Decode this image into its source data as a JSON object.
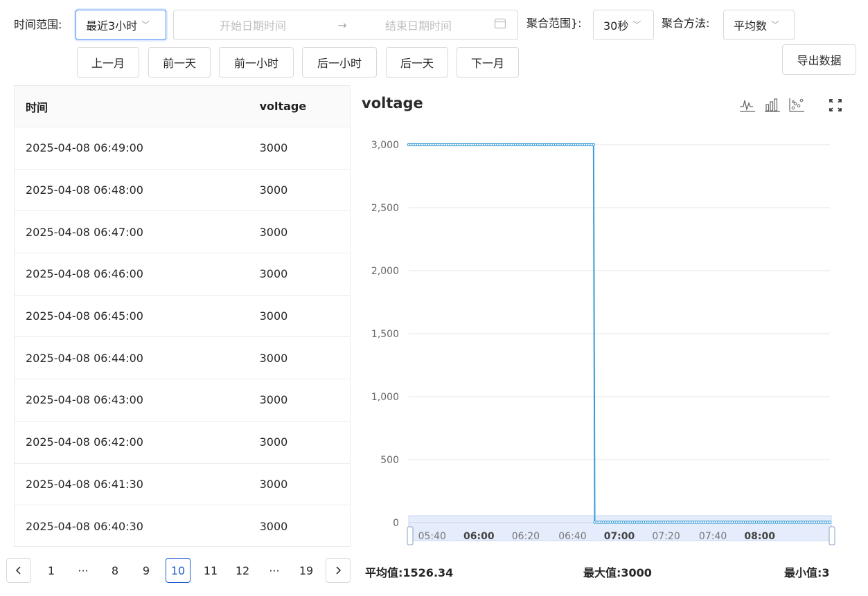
{
  "filters": {
    "time_range_label": "时间范围:",
    "time_range_value": "最近3小时",
    "start_placeholder": "开始日期时间",
    "end_placeholder": "结束日期时间",
    "agg_range_label": "聚合范围}:",
    "agg_range_value": "30秒",
    "agg_method_label": "聚合方法:",
    "agg_method_value": "平均数",
    "export_label": "导出数据"
  },
  "nav_buttons": [
    "上一月",
    "前一天",
    "前一小时",
    "后一小时",
    "后一天",
    "下一月"
  ],
  "table": {
    "headers": [
      "时间",
      "voltage"
    ],
    "rows": [
      [
        "2025-04-08 06:49:00",
        "3000"
      ],
      [
        "2025-04-08 06:48:00",
        "3000"
      ],
      [
        "2025-04-08 06:47:00",
        "3000"
      ],
      [
        "2025-04-08 06:46:00",
        "3000"
      ],
      [
        "2025-04-08 06:45:00",
        "3000"
      ],
      [
        "2025-04-08 06:44:00",
        "3000"
      ],
      [
        "2025-04-08 06:43:00",
        "3000"
      ],
      [
        "2025-04-08 06:42:00",
        "3000"
      ],
      [
        "2025-04-08 06:41:30",
        "3000"
      ],
      [
        "2025-04-08 06:40:30",
        "3000"
      ]
    ]
  },
  "pagination": {
    "pages": [
      "1",
      "···",
      "8",
      "9",
      "10",
      "11",
      "12",
      "···",
      "19"
    ],
    "current": "10",
    "prev_icon": "chevron-left-icon",
    "next_icon": "chevron-right-icon"
  },
  "chart_toolbar": [
    "line-chart-icon",
    "bar-chart-icon",
    "scatter-chart-icon",
    "fullscreen-icon"
  ],
  "chart_data": {
    "type": "line",
    "title": "voltage",
    "xlabel": "",
    "ylabel": "",
    "ylim": [
      0,
      3000
    ],
    "y_ticks": [
      "0",
      "500",
      "1,000",
      "1,500",
      "2,000",
      "2,500",
      "3,000"
    ],
    "x_ticks": [
      "05:40",
      "06:00",
      "06:20",
      "06:40",
      "07:00",
      "07:20",
      "07:40",
      "08:00"
    ],
    "x_ticks_bold": [
      "06:00",
      "07:00",
      "08:00"
    ],
    "grid": true,
    "series": [
      {
        "color": "#3a9bd5",
        "points": [
          [
            "05:30",
            3000
          ],
          [
            "06:49",
            3000
          ],
          [
            "06:49:30",
            3
          ],
          [
            "08:30",
            3
          ]
        ]
      }
    ],
    "accent": "#3a9bd5"
  },
  "stats": {
    "avg_label": "平均值:",
    "avg_value": "1526.34",
    "max_label": "最大值:",
    "max_value": "3000",
    "min_label": "最小值:",
    "min_value": "3"
  }
}
